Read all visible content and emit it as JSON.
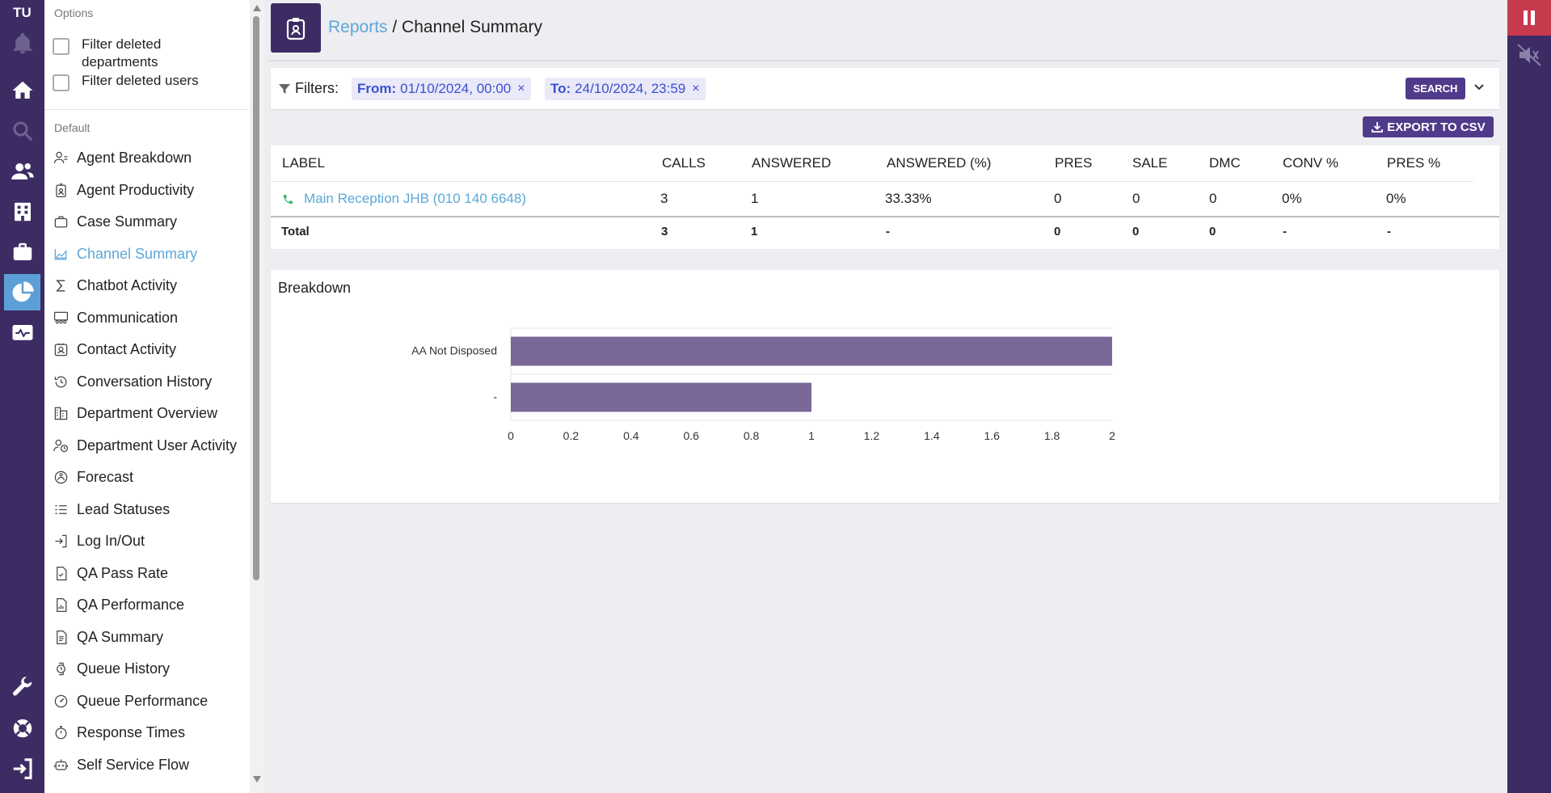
{
  "app": {
    "user_initials": "TU"
  },
  "rail_icons": [
    "bell-icon",
    "home-icon",
    "search-icon",
    "users-icon",
    "building-icon",
    "briefcase-icon",
    "pie-chart-icon",
    "monitor-icon",
    "wrench-icon",
    "support-icon",
    "logout-icon"
  ],
  "sidebar": {
    "options_title": "Options",
    "filter_deleted_departments": "Filter deleted departments",
    "filter_deleted_users": "Filter deleted users",
    "default_title": "Default",
    "items": [
      {
        "label": "Agent Breakdown",
        "icon": "agent-icon"
      },
      {
        "label": "Agent Productivity",
        "icon": "badge-icon"
      },
      {
        "label": "Case Summary",
        "icon": "briefcase-icon"
      },
      {
        "label": "Channel Summary",
        "icon": "chart-area-icon",
        "active": true
      },
      {
        "label": "Chatbot Activity",
        "icon": "sigma-icon"
      },
      {
        "label": "Communication",
        "icon": "group-icon"
      },
      {
        "label": "Contact Activity",
        "icon": "contact-card-icon"
      },
      {
        "label": "Conversation History",
        "icon": "history-icon"
      },
      {
        "label": "Department Overview",
        "icon": "building-icon"
      },
      {
        "label": "Department User Activity",
        "icon": "user-clock-icon"
      },
      {
        "label": "Forecast",
        "icon": "forecast-icon"
      },
      {
        "label": "Lead Statuses",
        "icon": "list-status-icon"
      },
      {
        "label": "Log In/Out",
        "icon": "login-icon"
      },
      {
        "label": "QA Pass Rate",
        "icon": "file-check-icon"
      },
      {
        "label": "QA Performance",
        "icon": "file-chart-icon"
      },
      {
        "label": "QA Summary",
        "icon": "file-text-icon"
      },
      {
        "label": "Queue History",
        "icon": "watch-icon"
      },
      {
        "label": "Queue Performance",
        "icon": "gauge-icon"
      },
      {
        "label": "Response Times",
        "icon": "stopwatch-icon"
      },
      {
        "label": "Self Service Flow",
        "icon": "robot-icon"
      }
    ]
  },
  "header": {
    "breadcrumb_link": "Reports",
    "separator": " / ",
    "title": "Channel Summary"
  },
  "filters": {
    "label": "Filters:",
    "from_key": "From:",
    "from_value": "01/10/2024, 00:00",
    "to_key": "To:",
    "to_value": "24/10/2024, 23:59",
    "search_label": "SEARCH",
    "remove_glyph": "×"
  },
  "export_label": "EXPORT TO CSV",
  "table": {
    "columns": [
      "LABEL",
      "CALLS",
      "ANSWERED",
      "ANSWERED (%)",
      "PRES",
      "SALE",
      "DMC",
      "CONV %",
      "PRES %"
    ],
    "rows": [
      [
        "Main Reception JHB (010 140 6648)",
        "3",
        "1",
        "33.33%",
        "0",
        "0",
        "0",
        "0%",
        "0%"
      ]
    ],
    "total": [
      "Total",
      "3",
      "1",
      "-",
      "0",
      "0",
      "0",
      "-",
      "-"
    ]
  },
  "breakdown_title": "Breakdown",
  "colors": {
    "brand": "#3c2c63",
    "accent": "#5da8d8",
    "bar": "#7a6898",
    "button": "#503b8b",
    "alert": "#c83a4e"
  },
  "chart_data": {
    "type": "bar",
    "orientation": "horizontal",
    "categories": [
      "AA Not Disposed",
      "-"
    ],
    "values": [
      2,
      1
    ],
    "xlim": [
      0,
      2
    ],
    "xticks": [
      "0",
      "0.2",
      "0.4",
      "0.6",
      "0.8",
      "1",
      "1.2",
      "1.4",
      "1.6",
      "1.8",
      "2"
    ],
    "grid": true
  }
}
